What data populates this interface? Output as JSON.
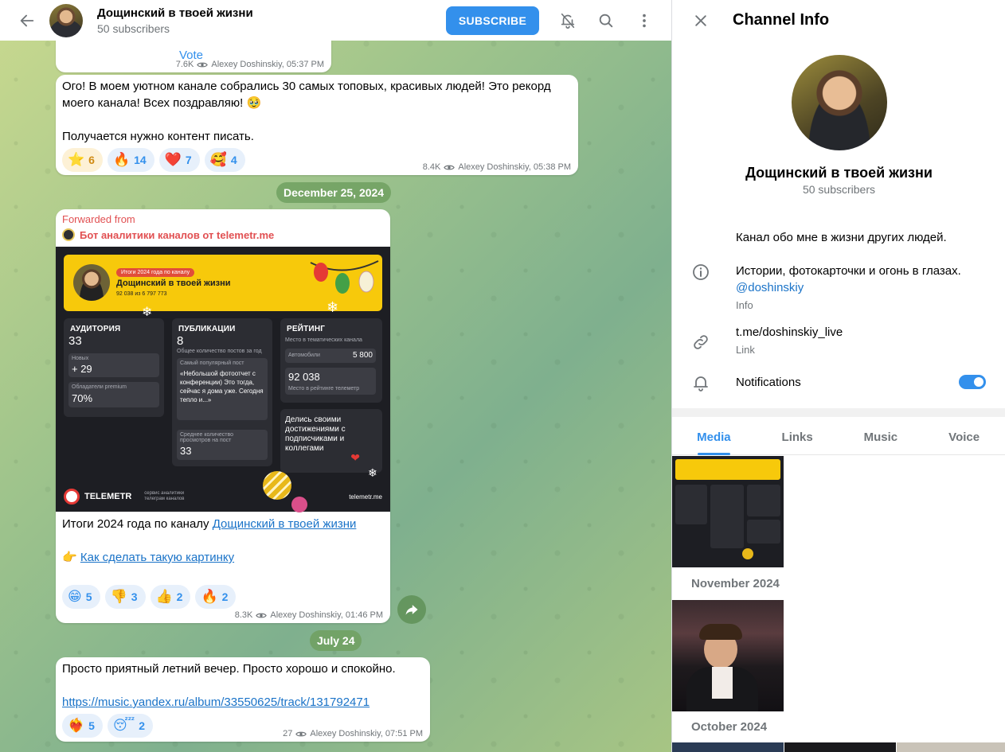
{
  "header": {
    "title": "Дощинский в твоей жизни",
    "subtitle": "50 subscribers",
    "subscribe_label": "SUBSCRIBE"
  },
  "messages": {
    "poll": {
      "vote_label": "Vote",
      "views": "7.6K",
      "author_time": "Alexey Doshinskiy, 05:37 PM"
    },
    "msg2": {
      "line1": "Ого! В моем уютном канале собрались 30 самых топовых, красивых людей! Это рекорд моего канала! Всех поздравляю! 🥹",
      "line2": "Получается нужно контент писать.",
      "reactions": [
        {
          "emoji": "⭐",
          "count": "6"
        },
        {
          "emoji": "🔥",
          "count": "14"
        },
        {
          "emoji": "❤️",
          "count": "7"
        },
        {
          "emoji": "🥰",
          "count": "4"
        }
      ],
      "views": "8.4K",
      "author_time": "Alexey Doshinskiy, 05:38 PM"
    },
    "date1": "December 25, 2024",
    "msg3": {
      "forwarded_label": "Forwarded from",
      "forward_source": "Бот аналитики каналов от telemetr.me",
      "text_prefix": "Итоги 2024 года по каналу ",
      "text_link": "Дощинский в твоей жизни",
      "cta_emoji": "👉",
      "cta_link": "Как сделать такую картинку",
      "reactions": [
        {
          "emoji": "😁",
          "count": "5"
        },
        {
          "emoji": "👎",
          "count": "3"
        },
        {
          "emoji": "👍",
          "count": "2"
        },
        {
          "emoji": "🔥",
          "count": "2"
        }
      ],
      "views": "8.3K",
      "author_time": "Alexey Doshinskiy, 01:46 PM",
      "promo": {
        "badge": "Итоги 2024 года по каналу",
        "channel": "Дощинский в твоей жизни",
        "rank_line": "92 038 из 6 797 773",
        "audience_title": "АУДИТОРИЯ",
        "audience_value": "33",
        "new_label": "Новых",
        "new_value": "+ 29",
        "premium_label": "Обладатели premium",
        "premium_value": "70%",
        "pubs_title": "ПУБЛИКАЦИИ",
        "pubs_value": "8",
        "pubs_sub": "Общее количество постов за год",
        "popular_label": "Самый популярный пост",
        "popular_text": "«Небольшой фотоотчет с конференции) Это тогда, сейчас я дома уже. Сегодня тепло и...»",
        "avg_label": "Среднее количество просмотров на пост",
        "avg_value": "33",
        "rating_title": "РЕЙТИНГ",
        "rating_sub": "Место в тематических канала",
        "rating_cat": "Автомобили",
        "rating_cat_value": "5 800",
        "rating_total": "92 038",
        "rating_total_sub": "Место в рейтинге телеметр",
        "share_text": "Делись своими достижениями с подписчиками и коллегами",
        "brand": "TELEMETR",
        "brand_sub": "сервис аналитики телеграм каналов",
        "site": "telemetr.me"
      }
    },
    "date2": "July 24",
    "msg4": {
      "text": "Просто приятный летний вечер. Просто хорошо и спокойно.",
      "link": "https://music.yandex.ru/album/33550625/track/131792471",
      "reactions": [
        {
          "emoji": "❤️‍🔥",
          "count": "5"
        },
        {
          "emoji": "😴",
          "count": "2"
        }
      ],
      "views": "27",
      "author_time": "Alexey Doshinskiy, 07:51 PM"
    }
  },
  "info_panel": {
    "title": "Channel Info",
    "name": "Дощинский в твоей жизни",
    "subscribers": "50 subscribers",
    "description_line1": "Канал обо мне в жизни других людей.",
    "description_line2": "Истории, фотокарточки и огонь в глазах.",
    "username": "@doshinskiy",
    "info_caption": "Info",
    "link": "t.me/doshinskiy_live",
    "link_caption": "Link",
    "notifications_label": "Notifications",
    "notifications_on": true,
    "tabs": [
      "Media",
      "Links",
      "Music",
      "Voice"
    ],
    "active_tab": "Media",
    "months": [
      "November 2024",
      "October 2024"
    ]
  },
  "colors": {
    "accent": "#3390ec",
    "forward_red": "#e15052",
    "promo_yellow": "#f7c90b",
    "promo_dark": "#1d1e23"
  }
}
